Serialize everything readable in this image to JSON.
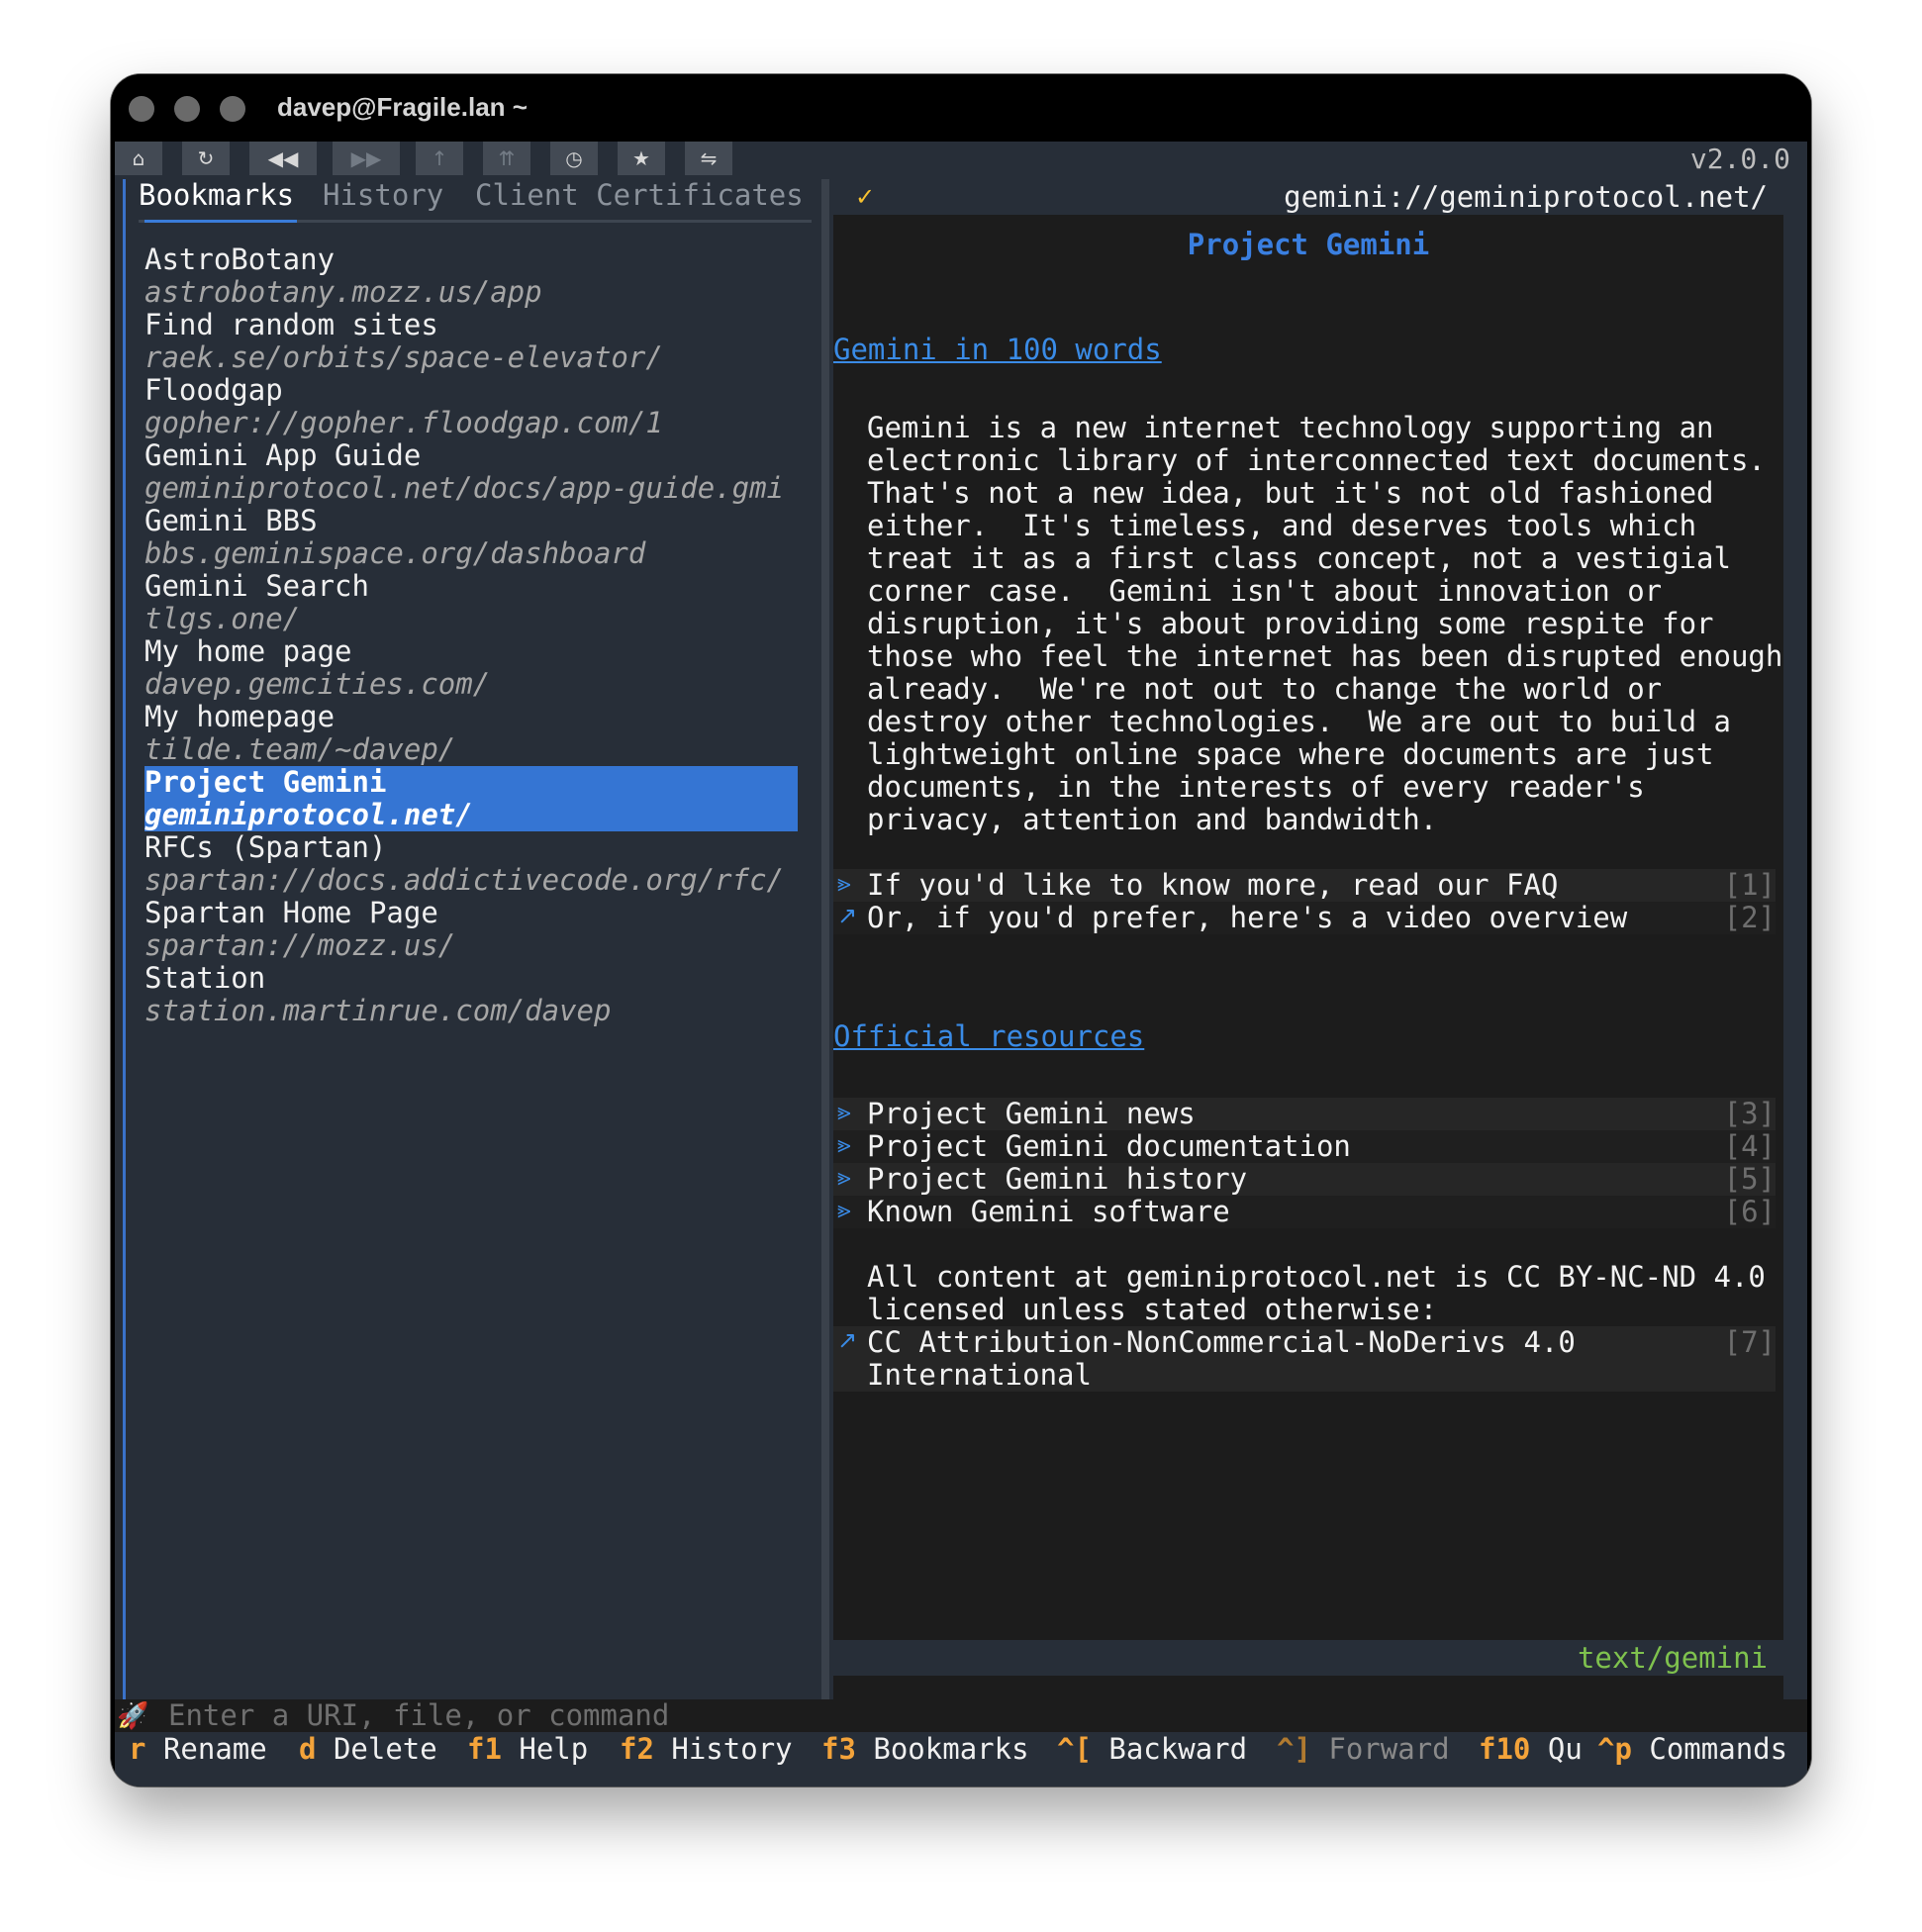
{
  "window": {
    "title": "davep@Fragile.lan ~"
  },
  "toolbar": {
    "buttons": [
      {
        "icon": "home-icon",
        "glyph": "⌂"
      },
      {
        "icon": "reload-icon",
        "glyph": "↻"
      },
      {
        "icon": "back-icon",
        "glyph": "◀◀"
      },
      {
        "icon": "forward-icon",
        "glyph": "▶▶"
      },
      {
        "icon": "up-icon",
        "glyph": "↑"
      },
      {
        "icon": "root-icon",
        "glyph": "⇈"
      },
      {
        "icon": "history-icon",
        "glyph": "◷"
      },
      {
        "icon": "bookmark-icon",
        "glyph": "★"
      },
      {
        "icon": "toggle-icon",
        "glyph": "⇋"
      }
    ],
    "version": "v2.0.0"
  },
  "tabs": [
    {
      "label": "Bookmarks",
      "active": true
    },
    {
      "label": "History",
      "active": false
    },
    {
      "label": "Client Certificates",
      "active": false
    }
  ],
  "bookmarks": [
    {
      "title": "AstroBotany",
      "url": "astrobotany.mozz.us/app"
    },
    {
      "title": "Find random sites",
      "url": "raek.se/orbits/space-elevator/"
    },
    {
      "title": "Floodgap",
      "url": "gopher://gopher.floodgap.com/1"
    },
    {
      "title": "Gemini App Guide",
      "url": "geminiprotocol.net/docs/app-guide.gmi"
    },
    {
      "title": "Gemini BBS",
      "url": "bbs.geminispace.org/dashboard"
    },
    {
      "title": "Gemini Search",
      "url": "tlgs.one/"
    },
    {
      "title": "My home page",
      "url": "davep.gemcities.com/"
    },
    {
      "title": "My homepage",
      "url": "tilde.team/~davep/"
    },
    {
      "title": "Project Gemini",
      "url": "geminiprotocol.net/",
      "selected": true
    },
    {
      "title": "RFCs (Spartan)",
      "url": "spartan://docs.addictivecode.org/rfc/"
    },
    {
      "title": "Spartan Home Page",
      "url": "spartan://mozz.us/"
    },
    {
      "title": "Station",
      "url": "station.martinrue.com/davep"
    }
  ],
  "viewer": {
    "status_check": "✓",
    "url": "gemini://geminiprotocol.net/",
    "page_title": "Project Gemini",
    "section1_heading": "Gemini in 100 words",
    "paragraph1": [
      "Gemini is a new internet technology supporting an",
      "electronic library of interconnected text documents.",
      "That's not a new idea, but it's not old fashioned",
      "either.  It's timeless, and deserves tools which",
      "treat it as a first class concept, not a vestigial",
      "corner case.  Gemini isn't about innovation or",
      "disruption, it's about providing some respite for",
      "those who feel the internet has been disrupted enough",
      "already.  We're not out to change the world or",
      "destroy other technologies.  We are out to build a",
      "lightweight online space where documents are just",
      "documents, in the interests of every reader's",
      "privacy, attention and bandwidth."
    ],
    "links1": [
      {
        "icon": "internal-link-icon",
        "glyph": "⪢",
        "text": "If you'd like to know more, read our FAQ",
        "num": "[1]"
      },
      {
        "icon": "external-link-icon",
        "glyph": "↗",
        "text": "Or, if you'd prefer, here's a video overview",
        "num": "[2]"
      }
    ],
    "section2_heading": "Official resources",
    "links2": [
      {
        "icon": "internal-link-icon",
        "glyph": "⪢",
        "text": "Project Gemini news",
        "num": "[3]"
      },
      {
        "icon": "internal-link-icon",
        "glyph": "⪢",
        "text": "Project Gemini documentation",
        "num": "[4]"
      },
      {
        "icon": "internal-link-icon",
        "glyph": "⪢",
        "text": "Project Gemini history",
        "num": "[5]"
      },
      {
        "icon": "internal-link-icon",
        "glyph": "⪢",
        "text": "Known Gemini software",
        "num": "[6]"
      }
    ],
    "license_text": [
      "All content at geminiprotocol.net is CC BY-NC-ND 4.0",
      "licensed unless stated otherwise:"
    ],
    "license_link": {
      "icon": "external-link-icon",
      "glyph": "↗",
      "text": [
        "CC Attribution-NonCommercial-NoDerivs 4.0",
        "International"
      ],
      "num": "[7]"
    },
    "mime_type": "text/gemini"
  },
  "input": {
    "icon": "rocket-icon",
    "glyph": "🚀",
    "placeholder": "Enter a URI, file, or command"
  },
  "footer": [
    {
      "key": "r",
      "label": "Rename"
    },
    {
      "key": "d",
      "label": "Delete"
    },
    {
      "key": "f1",
      "label": "Help"
    },
    {
      "key": "f2",
      "label": "History"
    },
    {
      "key": "f3",
      "label": "Bookmarks"
    },
    {
      "key": "^[",
      "label": "Backward"
    },
    {
      "key": "^]",
      "label": "Forward",
      "dim": true
    },
    {
      "key": "f10",
      "label": "Qu"
    },
    {
      "key": "^p",
      "label": "Commands"
    }
  ],
  "colors": {
    "accent": "#3575d3",
    "link": "#3a8be6",
    "key": "#f3a33a",
    "mime": "#7fc24e",
    "check": "#f5c030"
  }
}
